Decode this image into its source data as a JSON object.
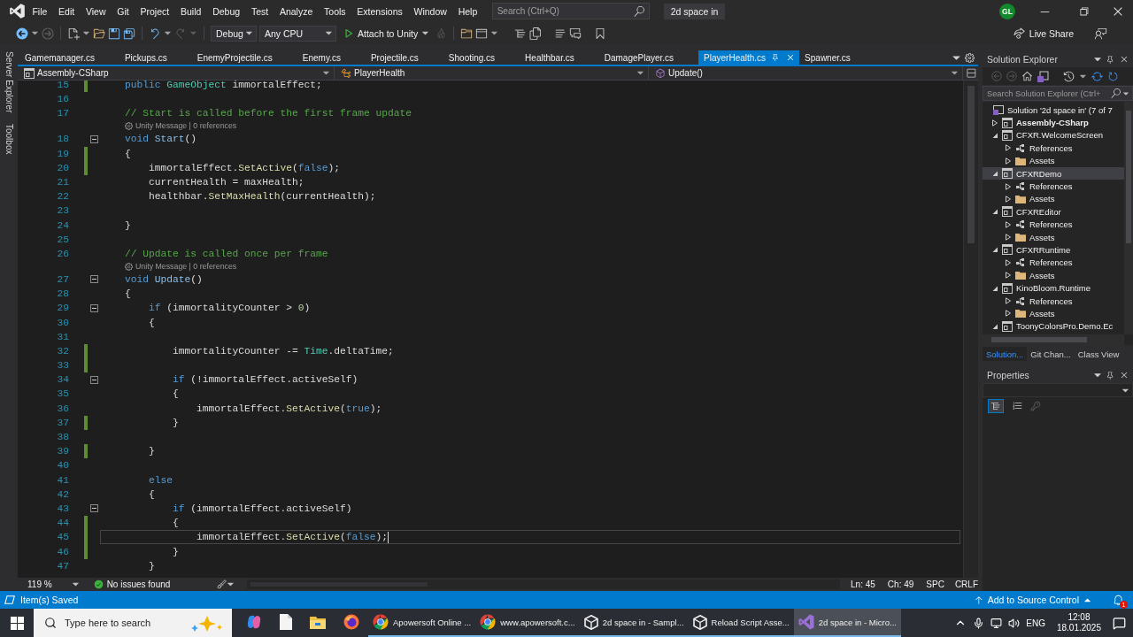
{
  "title_bar": {
    "menu": [
      "File",
      "Edit",
      "View",
      "Git",
      "Project",
      "Build",
      "Debug",
      "Test",
      "Analyze",
      "Tools",
      "Extensions",
      "Window",
      "Help"
    ],
    "search": {
      "placeholder": "Search (Ctrl+Q)"
    },
    "solution_name": "2d space in",
    "account": "GL"
  },
  "toolbar": {
    "configuration": "Debug",
    "platform": "Any CPU",
    "start_target": "Attach to Unity",
    "live_share": "Live Share"
  },
  "tool_strip": [
    "Server Explorer",
    "Toolbox"
  ],
  "document_tabs": [
    {
      "label": "Gamemanager.cs",
      "selected": false
    },
    {
      "label": "Pickups.cs",
      "selected": false
    },
    {
      "label": "EnemyProjectile.cs",
      "selected": false
    },
    {
      "label": "Enemy.cs",
      "selected": false
    },
    {
      "label": "Projectile.cs",
      "selected": false
    },
    {
      "label": "Shooting.cs",
      "selected": false
    },
    {
      "label": "Healthbar.cs",
      "selected": false
    },
    {
      "label": "DamagePlayer.cs",
      "selected": false
    },
    {
      "label": "PlayerHealth.cs",
      "selected": true
    },
    {
      "label": "Spawner.cs",
      "selected": false
    }
  ],
  "navigation_bar": {
    "project": "Assembly-CSharp",
    "type": "PlayerHealth",
    "member": "Update()"
  },
  "editor": {
    "lines": [
      {
        "kind": "code",
        "number": "15",
        "changed": true,
        "foldable": false,
        "current": false,
        "tokens": [
          {
            "kind": "keyword",
            "text": "    public "
          },
          {
            "kind": "type",
            "text": "GameObject"
          },
          {
            "kind": "plain",
            "text": " immortalEffect;"
          }
        ]
      },
      {
        "kind": "code",
        "number": "16",
        "changed": false,
        "foldable": false,
        "current": false
      },
      {
        "kind": "code",
        "number": "17",
        "changed": false,
        "foldable": false,
        "current": false,
        "tokens": [
          {
            "kind": "comment",
            "text": "    // Start is called before the first frame update"
          }
        ]
      },
      {
        "kind": "lens",
        "text": "Unity Message | 0 references"
      },
      {
        "kind": "code",
        "number": "18",
        "changed": false,
        "foldable": true,
        "current": false,
        "tokens": [
          {
            "kind": "keyword",
            "text": "    void "
          },
          {
            "kind": "message",
            "text": "Start"
          },
          {
            "kind": "plain",
            "text": "()"
          }
        ]
      },
      {
        "kind": "code",
        "number": "19",
        "changed": true,
        "foldable": false,
        "current": false,
        "tokens": [
          {
            "kind": "plain",
            "text": "    {"
          }
        ]
      },
      {
        "kind": "code",
        "number": "20",
        "changed": true,
        "foldable": false,
        "current": false,
        "tokens": [
          {
            "kind": "plain",
            "text": "        immortalEffect."
          },
          {
            "kind": "method",
            "text": "SetActive"
          },
          {
            "kind": "plain",
            "text": "("
          },
          {
            "kind": "keyword",
            "text": "false"
          },
          {
            "kind": "plain",
            "text": ");"
          }
        ]
      },
      {
        "kind": "code",
        "number": "21",
        "changed": false,
        "foldable": false,
        "current": false,
        "tokens": [
          {
            "kind": "plain",
            "text": "        currentHealth = maxHealth;"
          }
        ]
      },
      {
        "kind": "code",
        "number": "22",
        "changed": false,
        "foldable": false,
        "current": false,
        "tokens": [
          {
            "kind": "plain",
            "text": "        healthbar."
          },
          {
            "kind": "method",
            "text": "SetMaxHealth"
          },
          {
            "kind": "plain",
            "text": "(currentHealth);"
          }
        ]
      },
      {
        "kind": "code",
        "number": "23",
        "changed": false,
        "foldable": false,
        "current": false
      },
      {
        "kind": "code",
        "number": "24",
        "changed": false,
        "foldable": false,
        "current": false,
        "tokens": [
          {
            "kind": "plain",
            "text": "    }"
          }
        ]
      },
      {
        "kind": "code",
        "number": "25",
        "changed": false,
        "foldable": false,
        "current": false
      },
      {
        "kind": "code",
        "number": "26",
        "changed": false,
        "foldable": false,
        "current": false,
        "tokens": [
          {
            "kind": "comment",
            "text": "    // Update is called once per frame"
          }
        ]
      },
      {
        "kind": "lens",
        "text": "Unity Message | 0 references"
      },
      {
        "kind": "code",
        "number": "27",
        "changed": false,
        "foldable": true,
        "current": false,
        "tokens": [
          {
            "kind": "keyword",
            "text": "    void "
          },
          {
            "kind": "message",
            "text": "Update"
          },
          {
            "kind": "plain",
            "text": "()"
          }
        ]
      },
      {
        "kind": "code",
        "number": "28",
        "changed": false,
        "foldable": false,
        "current": false,
        "tokens": [
          {
            "kind": "plain",
            "text": "    {"
          }
        ]
      },
      {
        "kind": "code",
        "number": "29",
        "changed": false,
        "foldable": true,
        "current": false,
        "tokens": [
          {
            "kind": "keyword",
            "text": "        if"
          },
          {
            "kind": "plain",
            "text": " (immortalityCounter > "
          },
          {
            "kind": "number",
            "text": "0"
          },
          {
            "kind": "plain",
            "text": ")"
          }
        ]
      },
      {
        "kind": "code",
        "number": "30",
        "changed": false,
        "foldable": false,
        "current": false,
        "tokens": [
          {
            "kind": "plain",
            "text": "        {"
          }
        ]
      },
      {
        "kind": "code",
        "number": "31",
        "changed": false,
        "foldable": false,
        "current": false
      },
      {
        "kind": "code",
        "number": "32",
        "changed": true,
        "foldable": false,
        "current": false,
        "tokens": [
          {
            "kind": "plain",
            "text": "            immortalityCounter -= "
          },
          {
            "kind": "type",
            "text": "Time"
          },
          {
            "kind": "plain",
            "text": ".deltaTime;"
          }
        ]
      },
      {
        "kind": "code",
        "number": "33",
        "changed": true,
        "foldable": false,
        "current": false
      },
      {
        "kind": "code",
        "number": "34",
        "changed": false,
        "foldable": true,
        "current": false,
        "tokens": [
          {
            "kind": "keyword",
            "text": "            if"
          },
          {
            "kind": "plain",
            "text": " (!immortalEffect.activeSelf)"
          }
        ]
      },
      {
        "kind": "code",
        "number": "35",
        "changed": false,
        "foldable": false,
        "current": false,
        "tokens": [
          {
            "kind": "plain",
            "text": "            {"
          }
        ]
      },
      {
        "kind": "code",
        "number": "36",
        "changed": false,
        "foldable": false,
        "current": false,
        "tokens": [
          {
            "kind": "plain",
            "text": "                immortalEffect."
          },
          {
            "kind": "method",
            "text": "SetActive"
          },
          {
            "kind": "plain",
            "text": "("
          },
          {
            "kind": "keyword",
            "text": "true"
          },
          {
            "kind": "plain",
            "text": ");"
          }
        ]
      },
      {
        "kind": "code",
        "number": "37",
        "changed": true,
        "foldable": false,
        "current": false,
        "tokens": [
          {
            "kind": "plain",
            "text": "            }"
          }
        ]
      },
      {
        "kind": "code",
        "number": "38",
        "changed": false,
        "foldable": false,
        "current": false
      },
      {
        "kind": "code",
        "number": "39",
        "changed": true,
        "foldable": false,
        "current": false,
        "tokens": [
          {
            "kind": "plain",
            "text": "        }"
          }
        ]
      },
      {
        "kind": "code",
        "number": "40",
        "changed": false,
        "foldable": false,
        "current": false
      },
      {
        "kind": "code",
        "number": "41",
        "changed": false,
        "foldable": false,
        "current": false,
        "tokens": [
          {
            "kind": "keyword",
            "text": "        else"
          }
        ]
      },
      {
        "kind": "code",
        "number": "42",
        "changed": false,
        "foldable": false,
        "current": false,
        "tokens": [
          {
            "kind": "plain",
            "text": "        {"
          }
        ]
      },
      {
        "kind": "code",
        "number": "43",
        "changed": false,
        "foldable": true,
        "current": false,
        "tokens": [
          {
            "kind": "keyword",
            "text": "            if"
          },
          {
            "kind": "plain",
            "text": " (immortalEffect.activeSelf)"
          }
        ]
      },
      {
        "kind": "code",
        "number": "44",
        "changed": true,
        "foldable": false,
        "current": false,
        "tokens": [
          {
            "kind": "plain",
            "text": "            {"
          }
        ]
      },
      {
        "kind": "code",
        "number": "45",
        "changed": true,
        "foldable": false,
        "current": true,
        "tokens": [
          {
            "kind": "plain",
            "text": "                immortalEffect."
          },
          {
            "kind": "method",
            "text": "SetActive"
          },
          {
            "kind": "plain",
            "text": "("
          },
          {
            "kind": "keyword",
            "text": "false"
          },
          {
            "kind": "plain",
            "text": ");"
          }
        ]
      },
      {
        "kind": "code",
        "number": "46",
        "changed": true,
        "foldable": false,
        "current": false,
        "tokens": [
          {
            "kind": "plain",
            "text": "            }"
          }
        ]
      },
      {
        "kind": "code",
        "number": "47",
        "changed": false,
        "foldable": false,
        "current": false,
        "tokens": [
          {
            "kind": "plain",
            "text": "        }"
          }
        ]
      }
    ]
  },
  "editor_status": {
    "zoom": "119 %",
    "issues": "No issues found",
    "line": "Ln: 45",
    "column": "Ch: 49",
    "indentation": "SPC",
    "line_endings": "CRLF"
  },
  "solution_explorer": {
    "title": "Solution Explorer",
    "search": {
      "placeholder": "Search Solution Explorer (Ctrl+"
    },
    "solution": {
      "label": "Solution '2d space in' (7 of 7",
      "projects": [
        {
          "kind": "project",
          "label": "Assembly-CSharp",
          "startup": true,
          "expanded": false,
          "selected": false
        },
        {
          "kind": "project",
          "label": "CFXR.WelcomeScreen",
          "startup": false,
          "expanded": true,
          "selected": false,
          "children": [
            {
              "kind": "references",
              "label": "References",
              "expanded": false,
              "selected": false
            },
            {
              "kind": "folder",
              "label": "Assets",
              "expanded": false,
              "selected": false
            }
          ]
        },
        {
          "kind": "project",
          "label": "CFXRDemo",
          "startup": false,
          "expanded": true,
          "selected": true,
          "children": [
            {
              "kind": "references",
              "label": "References",
              "expanded": false,
              "selected": false
            },
            {
              "kind": "folder",
              "label": "Assets",
              "expanded": false,
              "selected": false
            }
          ]
        },
        {
          "kind": "project",
          "label": "CFXREditor",
          "startup": false,
          "expanded": true,
          "selected": false,
          "children": [
            {
              "kind": "references",
              "label": "References",
              "expanded": false,
              "selected": false
            },
            {
              "kind": "folder",
              "label": "Assets",
              "expanded": false,
              "selected": false
            }
          ]
        },
        {
          "kind": "project",
          "label": "CFXRRuntime",
          "startup": false,
          "expanded": true,
          "selected": false,
          "children": [
            {
              "kind": "references",
              "label": "References",
              "expanded": false,
              "selected": false
            },
            {
              "kind": "folder",
              "label": "Assets",
              "expanded": false,
              "selected": false
            }
          ]
        },
        {
          "kind": "project",
          "label": "KinoBloom.Runtime",
          "startup": false,
          "expanded": true,
          "selected": false,
          "children": [
            {
              "kind": "references",
              "label": "References",
              "expanded": false,
              "selected": false
            },
            {
              "kind": "folder",
              "label": "Assets",
              "expanded": false,
              "selected": false
            }
          ]
        },
        {
          "kind": "project",
          "label": "ToonyColorsPro.Demo.Ec",
          "startup": false,
          "expanded": true,
          "selected": false
        }
      ]
    },
    "tabs": [
      {
        "label": "Solution...",
        "selected": true
      },
      {
        "label": "Git Chan...",
        "selected": false
      },
      {
        "label": "Class View",
        "selected": false
      }
    ]
  },
  "properties": {
    "title": "Properties",
    "categorized": true,
    "alphabetical": false
  },
  "status_bar": {
    "message": "Item(s) Saved",
    "source_control": "Add to Source Control",
    "notification_count": "1"
  },
  "taskbar": {
    "search": {
      "placeholder": "Type here to search"
    },
    "apps": [
      {
        "kind": "copilot",
        "selected": false
      },
      {
        "kind": "notepad",
        "selected": false
      },
      {
        "kind": "explorer",
        "selected": false
      },
      {
        "kind": "firefox",
        "selected": false
      },
      {
        "kind": "chrome",
        "label": "Apowersoft Online ...",
        "selected": false
      },
      {
        "kind": "chrome",
        "label": "www.apowersoft.c...",
        "selected": false
      },
      {
        "kind": "unity",
        "label": "2d space in - Sampl...",
        "selected": false
      },
      {
        "kind": "unity",
        "label": "Reload Script Asse...",
        "selected": false
      },
      {
        "kind": "visual_studio",
        "label": "2d space in - Micro...",
        "selected": true
      }
    ],
    "language": "ENG",
    "time": "12:08",
    "date": "18.01.2025"
  }
}
